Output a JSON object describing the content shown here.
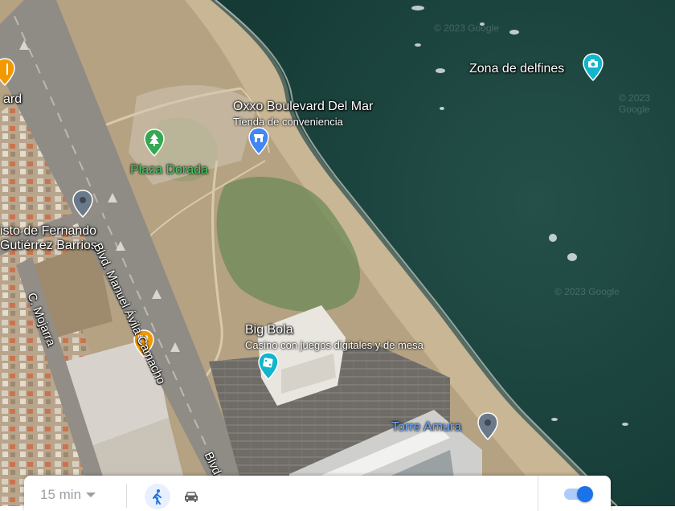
{
  "map": {
    "places": {
      "zona_delfines": "Zona de delfines",
      "oxxo_name": "Oxxo Boulevard Del Mar",
      "oxxo_category": "Tienda de conveniencia",
      "plaza_dorada": "Plaza Dorada",
      "fernando_line1": "isto de Fernando",
      "fernando_line2": "Gutiérrez Barrios",
      "big_bola_name": "Big Bola",
      "big_bola_category": "Casino con juegos digitales y de mesa",
      "torre_amura": "Torre Amura",
      "partial_left": "ard"
    },
    "roads": {
      "manuel_avila": "Blvd. Manuel Ávila Camacho",
      "mojarra": "C. Mojarra",
      "blvd_partial": "Blvd"
    },
    "watermarks": [
      "© 2023 Google",
      "© 2023 Google",
      "© 2023 Google"
    ]
  },
  "bottom_bar": {
    "time_value": "15 min",
    "walk_icon": "walking-icon",
    "car_icon": "car-icon",
    "toggle_on": true
  },
  "colors": {
    "sea": "#1f4a44",
    "sand": "#c2ae8c",
    "accent_blue": "#1a73e8"
  }
}
